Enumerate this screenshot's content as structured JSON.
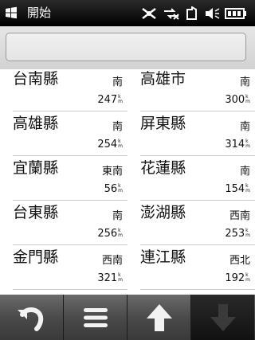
{
  "status": {
    "title": "開始",
    "icons": [
      "windows-start-icon",
      "gps-off-icon",
      "data-off-icon",
      "sim-icon",
      "mute-icon",
      "battery-icon"
    ]
  },
  "search": {
    "placeholder": ""
  },
  "list": {
    "rows": [
      {
        "left": {
          "name": "台南縣",
          "dir": "南",
          "dist": "247"
        },
        "right": {
          "name": "高雄市",
          "dir": "南",
          "dist": "300"
        }
      },
      {
        "left": {
          "name": "高雄縣",
          "dir": "南",
          "dist": "254"
        },
        "right": {
          "name": "屏東縣",
          "dir": "南",
          "dist": "314"
        }
      },
      {
        "left": {
          "name": "宜蘭縣",
          "dir": "東南",
          "dist": "56"
        },
        "right": {
          "name": "花蓮縣",
          "dir": "南",
          "dist": "154"
        }
      },
      {
        "left": {
          "name": "台東縣",
          "dir": "南",
          "dist": "256"
        },
        "right": {
          "name": "澎湖縣",
          "dir": "西南",
          "dist": "253"
        }
      },
      {
        "left": {
          "name": "金門縣",
          "dir": "西南",
          "dist": "321"
        },
        "right": {
          "name": "連江縣",
          "dir": "西北",
          "dist": "192"
        }
      }
    ],
    "unit_top": "k",
    "unit_bottom": "m"
  },
  "toolbar": {
    "buttons": [
      "back-icon",
      "menu-icon",
      "up-arrow-icon",
      "down-arrow-icon"
    ]
  }
}
